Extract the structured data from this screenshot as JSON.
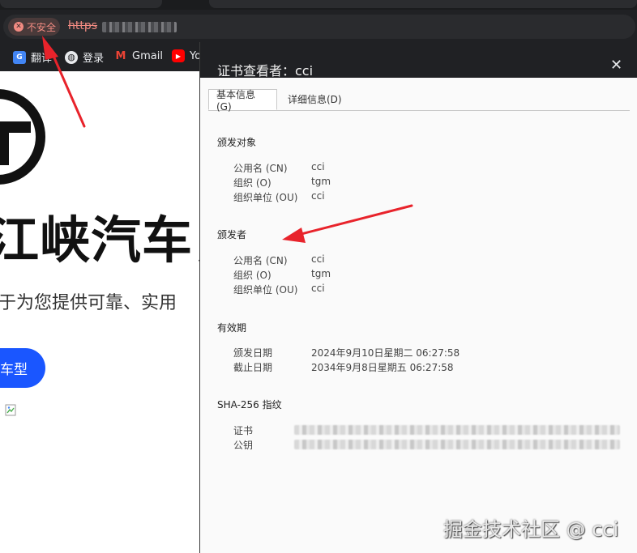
{
  "browser": {
    "security_chip_label": "不安全",
    "url_prefix": "https",
    "bookmarks": [
      {
        "icon": "translate-icon",
        "label": "翻译"
      },
      {
        "icon": "globe-icon",
        "label": "登录"
      },
      {
        "icon": "gmail-icon",
        "label": "Gmail"
      },
      {
        "icon": "youtube-icon",
        "label": "Yo"
      }
    ]
  },
  "webpage": {
    "hero_title": "江峡汽车，",
    "hero_subtitle": "于为您提供可靠、实用",
    "cta_label": "车型"
  },
  "dialog": {
    "title": "证书查看者：cci",
    "tabs": [
      {
        "label": "基本信息(G)",
        "active": true
      },
      {
        "label": "详细信息(D)",
        "active": false
      }
    ],
    "issued_to": {
      "heading": "颁发对象",
      "rows": [
        {
          "label": "公用名 (CN)",
          "value": "cci"
        },
        {
          "label": "组织 (O)",
          "value": "tgm"
        },
        {
          "label": "组织单位 (OU)",
          "value": "cci"
        }
      ]
    },
    "issued_by": {
      "heading": "颁发者",
      "rows": [
        {
          "label": "公用名 (CN)",
          "value": "cci"
        },
        {
          "label": "组织 (O)",
          "value": "tgm"
        },
        {
          "label": "组织单位 (OU)",
          "value": "cci"
        }
      ]
    },
    "validity": {
      "heading": "有效期",
      "rows": [
        {
          "label": "颁发日期",
          "value": "2024年9月10日星期二 06:27:58"
        },
        {
          "label": "截止日期",
          "value": "2034年9月8日星期五 06:27:58"
        }
      ]
    },
    "fingerprints": {
      "heading": "SHA-256 指纹",
      "rows": [
        {
          "label": "证书"
        },
        {
          "label": "公钥"
        }
      ]
    }
  },
  "watermark": "掘金技术社区 @ cci",
  "colors": {
    "warning": "#f28b82",
    "accent_button": "#1a56ff",
    "annotation_arrow": "#e8232b"
  }
}
